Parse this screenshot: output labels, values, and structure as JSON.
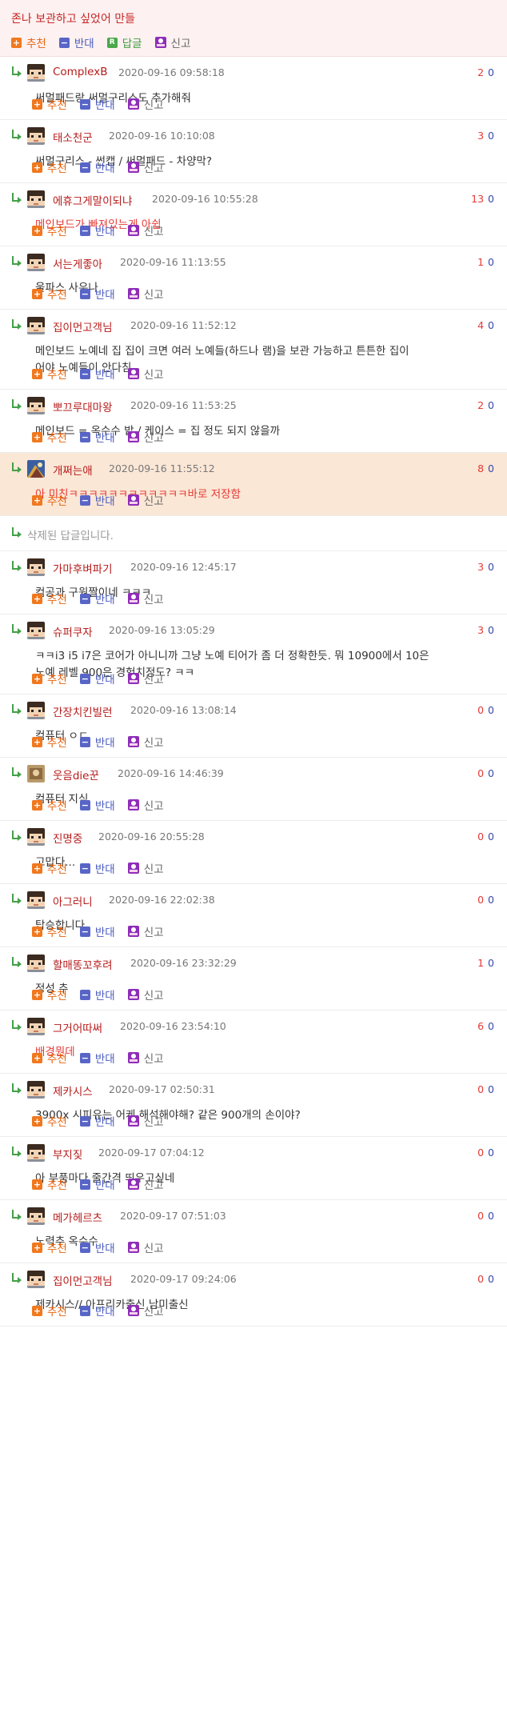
{
  "post": {
    "title": "존나 보관하고 싶었어 만들",
    "buttons": {
      "up": "추천",
      "down": "반대",
      "reply": "답글",
      "report": "신고"
    }
  },
  "button_labels": {
    "up": "추천",
    "down": "반대",
    "report": "신고"
  },
  "deleted_text": "삭제된 답글입니다.",
  "comments": [
    {
      "nick": "ComplexB",
      "date": "2020-09-16 09:58:18",
      "up": "2",
      "down": "0",
      "lines": [
        "써멀패드랑 써멀구리스도 추가해줘"
      ],
      "red": false,
      "avatar": "pixel"
    },
    {
      "nick": "태소천군",
      "date": "2020-09-16 10:10:08",
      "up": "3",
      "down": "0",
      "lines": [
        "써멀구리스 - 썬캡 / 써멀패드 - 차양막?"
      ],
      "red": false,
      "avatar": "pixel"
    },
    {
      "nick": "에휴그게말이되냐",
      "date": "2020-09-16 10:55:28",
      "up": "13",
      "down": "0",
      "lines": [
        "메인보드가 빠져있는게 아쉽"
      ],
      "red": true,
      "avatar": "pixel"
    },
    {
      "nick": "서는게좋아",
      "date": "2020-09-16 11:13:55",
      "up": "1",
      "down": "0",
      "lines": [
        "울파스 사우나"
      ],
      "red": false,
      "avatar": "pixel"
    },
    {
      "nick": "집이먼고객님",
      "date": "2020-09-16 11:52:12",
      "up": "4",
      "down": "0",
      "lines": [
        "메인보드 노예네 집 집이 크면 여러 노예들(하드나 램)을 보관 가능하고 튼튼한 집이",
        "어야 노예들이 안다침"
      ],
      "red": false,
      "avatar": "pixel"
    },
    {
      "nick": "뽀끄루대마왕",
      "date": "2020-09-16 11:53:25",
      "up": "2",
      "down": "0",
      "lines": [
        "메인보드 = 옥수수 밭 / 케이스 = 집 정도 되지 않을까"
      ],
      "red": false,
      "avatar": "pixel"
    },
    {
      "nick": "개쩌는애",
      "date": "2020-09-16 11:55:12",
      "up": "8",
      "down": "0",
      "lines": [
        "아 미친ㅋㅋㅋㅋㅋㅋㅋㅋㅋㅋㅋㅋ바로 저장함"
      ],
      "red": true,
      "avatar": "art",
      "highlight": true
    }
  ],
  "comments2": [
    {
      "nick": "가마후벼파기",
      "date": "2020-09-16 12:45:17",
      "up": "3",
      "down": "0",
      "lines": [
        "컴공과 구원짤이네 ㅋㅋㅋ"
      ],
      "red": false,
      "avatar": "pixel"
    },
    {
      "nick": "슈퍼쿠자",
      "date": "2020-09-16 13:05:29",
      "up": "3",
      "down": "0",
      "lines": [
        "ㅋㅋi3 i5 i7은 코어가 아니니까 그냥 노예 티어가 좀 더 정확한듯. 뭐 10900에서 10은",
        "노예 레벨 900은 경험치정도? ㅋㅋ"
      ],
      "red": false,
      "avatar": "pixel"
    },
    {
      "nick": "간장치킨빌런",
      "date": "2020-09-16 13:08:14",
      "up": "0",
      "down": "0",
      "lines": [
        "컴퓨터 ㅇㄷ"
      ],
      "red": false,
      "avatar": "pixel"
    },
    {
      "nick": "웃음die꾼",
      "date": "2020-09-16 14:46:39",
      "up": "0",
      "down": "0",
      "lines": [
        "컴퓨터 지식"
      ],
      "red": false,
      "avatar": "photo"
    },
    {
      "nick": "진명중",
      "date": "2020-09-16 20:55:28",
      "up": "0",
      "down": "0",
      "lines": [
        "고맙다..."
      ],
      "red": false,
      "avatar": "pixel"
    },
    {
      "nick": "아그러니",
      "date": "2020-09-16 22:02:38",
      "up": "0",
      "down": "0",
      "lines": [
        "탑승합니다"
      ],
      "red": false,
      "avatar": "pixel"
    },
    {
      "nick": "할매똥꼬후려",
      "date": "2020-09-16 23:32:29",
      "up": "1",
      "down": "0",
      "lines": [
        "정성 추"
      ],
      "red": false,
      "avatar": "pixel"
    },
    {
      "nick": "그거어따써",
      "date": "2020-09-16 23:54:10",
      "up": "6",
      "down": "0",
      "lines": [
        "배경뭔데"
      ],
      "red": true,
      "avatar": "pixel"
    },
    {
      "nick": "제카시스",
      "date": "2020-09-17 02:50:31",
      "up": "0",
      "down": "0",
      "lines": [
        "3900x 시피유는 어케 해석해야해? 같은 900개의 손이야?"
      ],
      "red": false,
      "avatar": "pixel"
    },
    {
      "nick": "부지짖",
      "date": "2020-09-17 07:04:12",
      "up": "0",
      "down": "0",
      "lines": [
        "아 부품마다 줄간격 띄우고싶네"
      ],
      "red": false,
      "avatar": "pixel"
    },
    {
      "nick": "메가헤르츠",
      "date": "2020-09-17 07:51:03",
      "up": "0",
      "down": "0",
      "lines": [
        "노력추 옥수수"
      ],
      "red": false,
      "avatar": "pixel"
    },
    {
      "nick": "집이먼고객님",
      "date": "2020-09-17 09:24:06",
      "up": "0",
      "down": "0",
      "lines": [
        "제카시스// 아프리카출신 남미출신"
      ],
      "red": false,
      "avatar": "pixel"
    }
  ],
  "colors": {
    "up": "#e53935",
    "down": "#3949ab",
    "nick": "#b71c1c",
    "highlight": "#fbe7d6"
  }
}
